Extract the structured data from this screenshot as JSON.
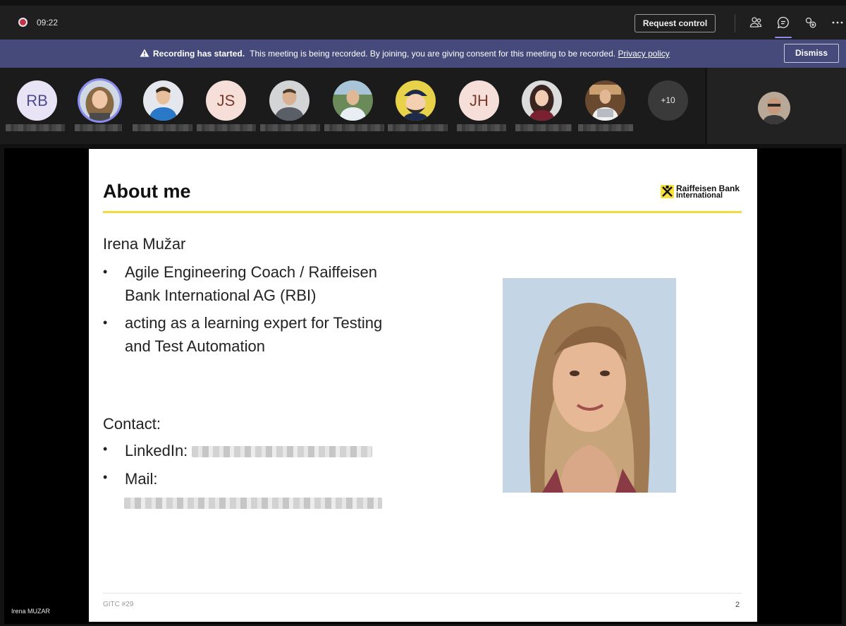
{
  "meeting": {
    "timer": "09:22",
    "request_control_label": "Request control",
    "presenter_name": "Irena MUZAR",
    "toolbar_icons": [
      "people-icon",
      "chat-icon",
      "apps-icon",
      "more-icon"
    ],
    "accent_color": "#8b8cf0"
  },
  "banner": {
    "bold": "Recording has started.",
    "message": "This meeting is being recorded. By joining, you are giving consent for this meeting to be recorded.",
    "link": "Privacy policy",
    "dismiss_label": "Dismiss",
    "background": "#464a7a"
  },
  "participants": {
    "initials": [
      "RB",
      "JS",
      "JH"
    ],
    "overflow": "+10"
  },
  "slide": {
    "title": "About me",
    "logo_line1": "Raiffeisen Bank",
    "logo_line2": "International",
    "name": "Irena Mužar",
    "bullets": [
      "Agile Engineering Coach / Raiffeisen Bank International AG (RBI)",
      "acting as a learning expert for Testing and Test Automation"
    ],
    "contact_label": "Contact:",
    "linkedin_label": "LinkedIn:",
    "mail_label": "Mail:",
    "footer_left": "GITC #29",
    "page_number": "2",
    "accent_color": "#f2dc3b"
  }
}
